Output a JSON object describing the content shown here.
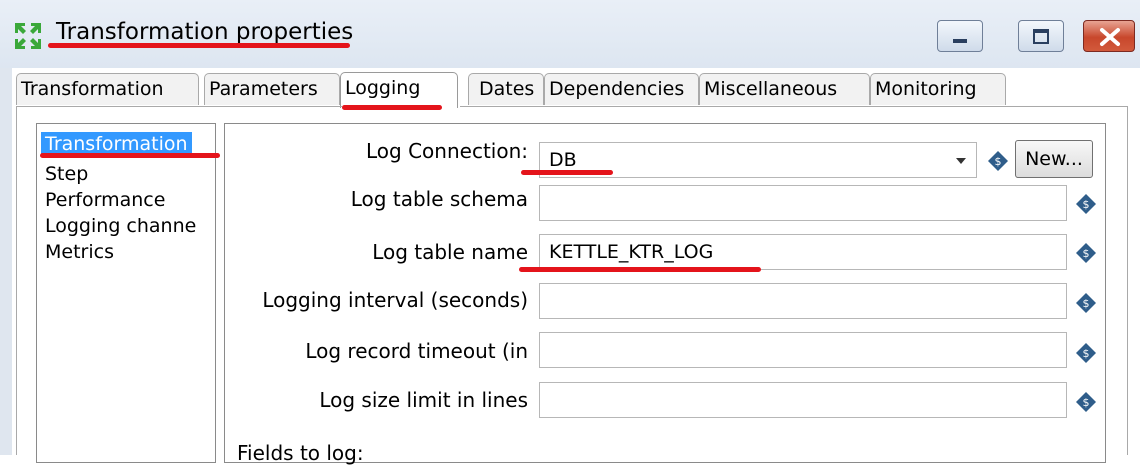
{
  "window": {
    "title": "Transformation properties",
    "controls": {
      "minimize": "minimize",
      "maximize": "maximize",
      "close": "close"
    }
  },
  "tabs": [
    {
      "label": "Transformation",
      "active": false
    },
    {
      "label": "Parameters",
      "active": false
    },
    {
      "label": "Logging",
      "active": true
    },
    {
      "label": "Dates",
      "active": false
    },
    {
      "label": "Dependencies",
      "active": false
    },
    {
      "label": "Miscellaneous",
      "active": false
    },
    {
      "label": "Monitoring",
      "active": false
    }
  ],
  "sidebar": {
    "items": [
      {
        "label": "Transformation",
        "selected": true
      },
      {
        "label": "Step",
        "selected": false
      },
      {
        "label": "Performance",
        "selected": false
      },
      {
        "label": "Logging channe",
        "selected": false
      },
      {
        "label": "Metrics",
        "selected": false
      }
    ]
  },
  "form": {
    "log_connection": {
      "label": "Log Connection:",
      "value": "DB",
      "new_button": "New..."
    },
    "log_table_schema": {
      "label": "Log table schema",
      "value": ""
    },
    "log_table_name": {
      "label": "Log table name",
      "value": "KETTLE_KTR_LOG"
    },
    "logging_interval": {
      "label": "Logging interval (seconds)",
      "value": ""
    },
    "log_record_timeout": {
      "label": "Log record timeout (in",
      "value": ""
    },
    "log_size_limit": {
      "label": "Log size limit in lines",
      "value": ""
    },
    "fields_to_log": "Fields to log:"
  },
  "colors": {
    "annotation_red": "#e4141b",
    "selection_blue": "#3399ff",
    "variable_icon": "#2f5d8a",
    "app_icon_green": "#3aa83a"
  },
  "icons": [
    "app-logo-icon",
    "minimize-icon",
    "maximize-icon",
    "close-icon",
    "dropdown-arrow-icon",
    "variable-dollar-icon"
  ]
}
